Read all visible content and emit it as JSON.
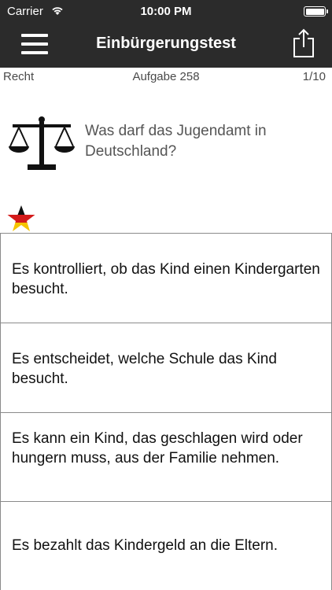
{
  "status": {
    "carrier": "Carrier",
    "time": "10:00 PM"
  },
  "nav": {
    "title": "Einbürgerungstest"
  },
  "subheader": {
    "category": "Recht",
    "task": "Aufgabe 258",
    "count": "1/10"
  },
  "question": {
    "text": "Was darf das Jugendamt in Deutschland?"
  },
  "answers": [
    "Es kontrolliert, ob das Kind einen Kindergarten besucht.",
    "Es entscheidet, welche Schule das Kind besucht.",
    "Es kann ein Kind, das geschlagen wird oder hungern muss, aus der Familie nehmen.",
    "Es bezahlt das Kindergeld an die Eltern."
  ],
  "icons": {
    "menu": "hamburger-menu-icon",
    "share": "share-icon",
    "question": "scale-of-justice-icon",
    "flag_star": "germany-flag-star-icon"
  }
}
